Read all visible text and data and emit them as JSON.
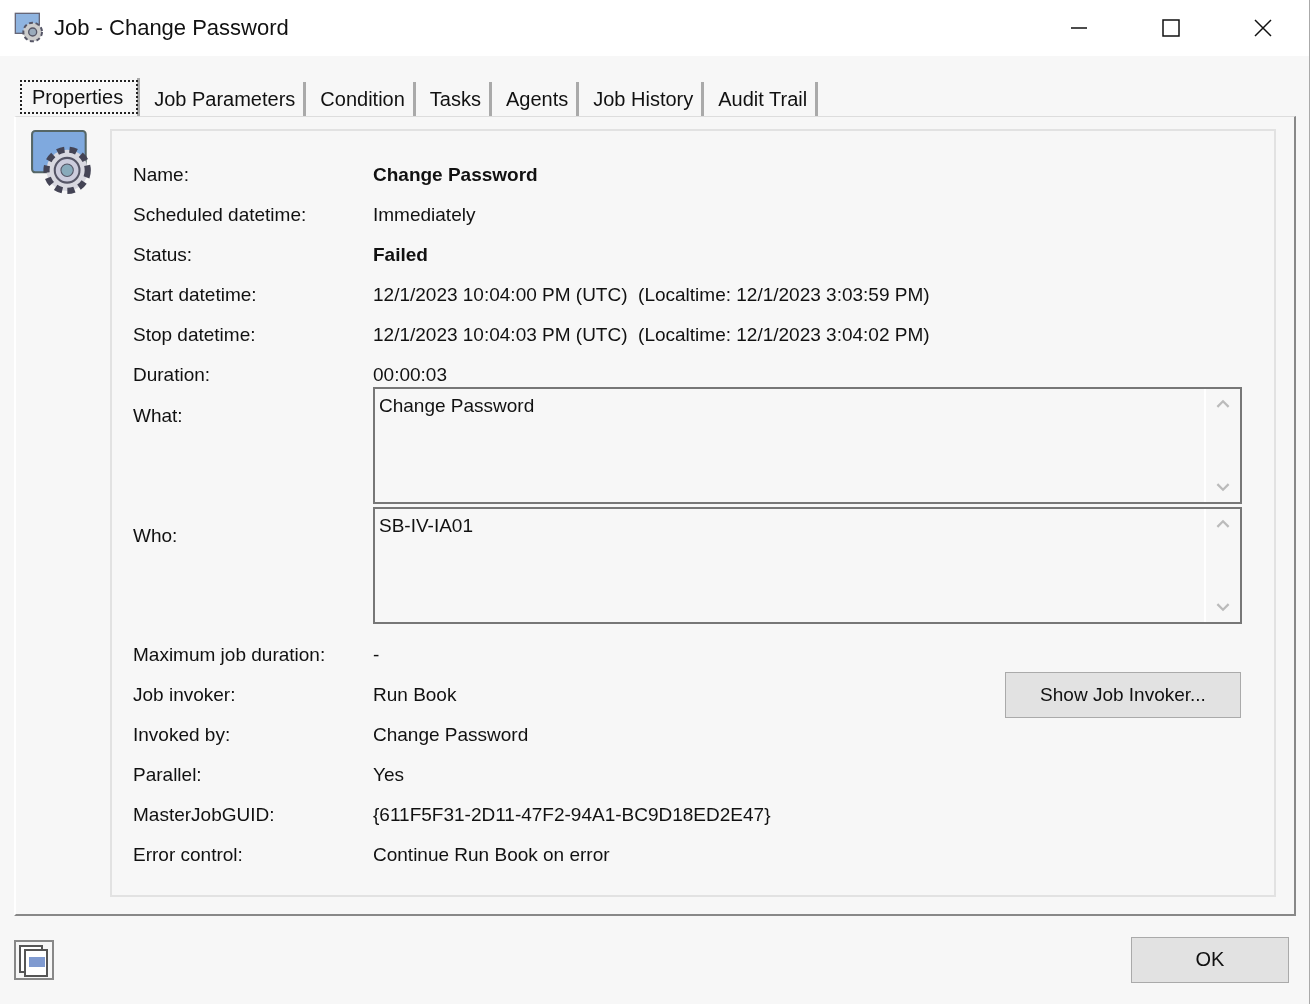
{
  "window": {
    "title": "Job - Change Password"
  },
  "tabs": [
    {
      "label": "Properties",
      "selected": true
    },
    {
      "label": "Job Parameters",
      "selected": false
    },
    {
      "label": "Condition",
      "selected": false
    },
    {
      "label": "Tasks",
      "selected": false
    },
    {
      "label": "Agents",
      "selected": false
    },
    {
      "label": "Job History",
      "selected": false
    },
    {
      "label": "Audit Trail",
      "selected": false
    }
  ],
  "fields": [
    {
      "label": "Name:",
      "value": "Change Password",
      "kind": "bold"
    },
    {
      "label": "Scheduled datetime:",
      "value": "Immediately",
      "kind": "text"
    },
    {
      "label": "Status:",
      "value": "Failed",
      "kind": "bold"
    },
    {
      "label": "Start datetime:",
      "value": "12/1/2023 10:04:00 PM (UTC)  (Localtime: 12/1/2023 3:03:59 PM)",
      "kind": "text"
    },
    {
      "label": "Stop datetime:",
      "value": "12/1/2023 10:04:03 PM (UTC)  (Localtime: 12/1/2023 3:04:02 PM)",
      "kind": "text"
    },
    {
      "label": "Duration:",
      "value": "00:00:03",
      "kind": "text"
    },
    {
      "label": "What:",
      "value": "Change Password",
      "kind": "textarea"
    },
    {
      "label": "Who:",
      "value": "SB-IV-IA01",
      "kind": "textarea"
    },
    {
      "label": "Maximum job duration:",
      "value": "-",
      "kind": "text"
    },
    {
      "label": "Job invoker:",
      "value": "Run Book",
      "kind": "button",
      "button": "Show Job Invoker..."
    },
    {
      "label": "Invoked by:",
      "value": "Change Password",
      "kind": "text"
    },
    {
      "label": "Parallel:",
      "value": "Yes",
      "kind": "text"
    },
    {
      "label": "MasterJobGUID:",
      "value": "{611F5F31-2D11-47F2-94A1-BC9D18ED2E47}",
      "kind": "text"
    },
    {
      "label": "Error control:",
      "value": "Continue Run Book on error",
      "kind": "text"
    }
  ],
  "ok_button": "OK"
}
